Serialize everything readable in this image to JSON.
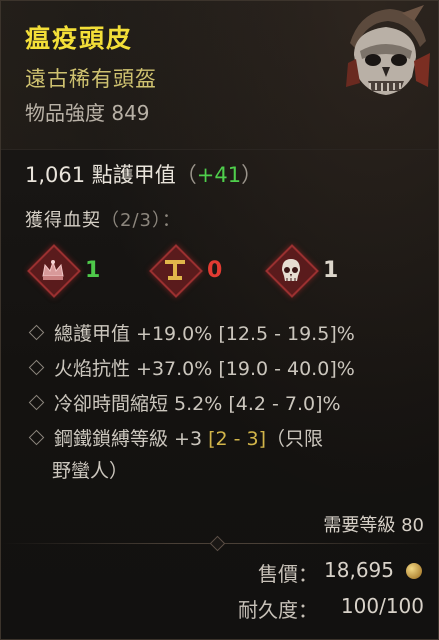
{
  "item": {
    "name": "瘟疫頭皮",
    "type": "遠古稀有頭盔",
    "power": "物品強度 849",
    "icon": "barbarian-helm-art"
  },
  "armor": {
    "value": "1,061 點護甲值",
    "bonus_open": "（",
    "bonus": "+41",
    "bonus_close": "）"
  },
  "blood_pact": {
    "title": "獲得血契",
    "count": "（2/3）：",
    "items": [
      {
        "icon": "crown-pact-icon",
        "value": "1",
        "color": "#4ec94a"
      },
      {
        "icon": "chalice-pact-icon",
        "value": "0",
        "color": "#e23b32"
      },
      {
        "icon": "skull-pact-icon",
        "value": "1",
        "color": "#dcd6cb"
      }
    ]
  },
  "affixes": [
    {
      "text": "總護甲值 +19.0% [12.5 - 19.5]%"
    },
    {
      "text": "火焰抗性 +37.0% [19.0 - 40.0]%"
    },
    {
      "text": "冷卻時間縮短 5.2% [4.2 - 7.0]%"
    },
    {
      "text_a": "鋼鐵鎖縛等級 +3 ",
      "range": "[2 - 3]",
      "text_b": "（只限",
      "cont": "野蠻人）"
    }
  ],
  "requirement": "需要等級 80",
  "price": {
    "label": "售價：",
    "value": "18,695",
    "icon": "gold-coin-icon"
  },
  "durability": {
    "label": "耐久度：",
    "value": "100/100"
  },
  "colors": {
    "name": "#f3df38",
    "type": "#cfc270",
    "bonus": "#4fcf4c"
  }
}
